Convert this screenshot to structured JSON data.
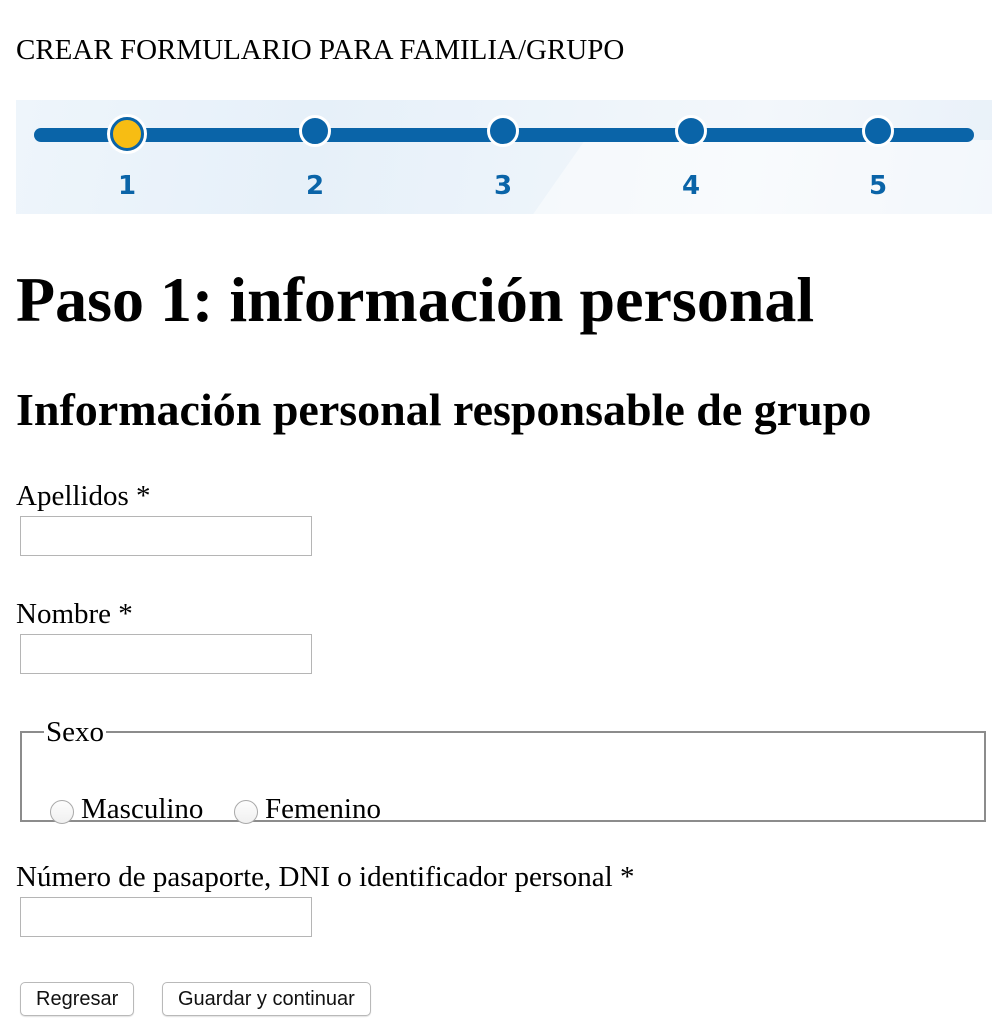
{
  "page": {
    "header": "CREAR FORMULARIO PARA FAMILIA/GRUPO"
  },
  "stepper": {
    "steps": [
      "1",
      "2",
      "3",
      "4",
      "5"
    ],
    "current_step": 1,
    "colors": {
      "track": "#0a64a8",
      "active": "#f7bd13"
    }
  },
  "main": {
    "title": "Paso 1: información personal",
    "section_title": "Información personal responsable de grupo"
  },
  "form": {
    "apellidos": {
      "label": "Apellidos *",
      "value": ""
    },
    "nombre": {
      "label": "Nombre *",
      "value": ""
    },
    "sexo": {
      "legend": "Sexo",
      "options": [
        "Masculino",
        "Femenino"
      ],
      "selected": null
    },
    "documento": {
      "label": "Número de pasaporte, DNI o identificador personal *",
      "value": ""
    }
  },
  "buttons": {
    "back": "Regresar",
    "save_continue": "Guardar y continuar"
  }
}
